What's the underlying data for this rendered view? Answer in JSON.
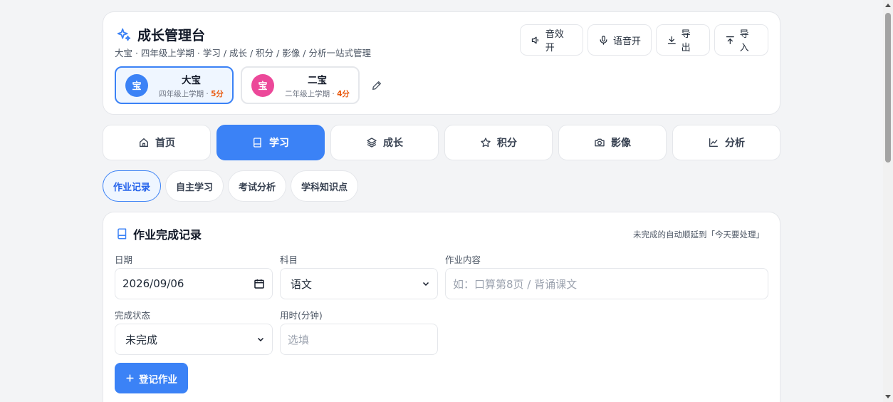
{
  "app": {
    "title": "成长管理台",
    "subtitle": "大宝 · 四年级上学期 · 学习 / 成长 / 积分 / 影像 / 分析一站式管理",
    "accent": "#3b82f6"
  },
  "top_actions": [
    {
      "label": "音效开",
      "icon": "speaker-icon"
    },
    {
      "label": "语音开",
      "icon": "microphone-icon"
    },
    {
      "label": "导出",
      "icon": "download-icon"
    },
    {
      "label": "导入",
      "icon": "upload-icon"
    }
  ],
  "kids": [
    {
      "avatar": "宝",
      "name": "大宝",
      "grade": "四年级上学期 · ",
      "score": "5分",
      "color": "#3b82f6",
      "active": true
    },
    {
      "avatar": "宝",
      "name": "二宝",
      "grade": "二年级上学期 · ",
      "score": "4分",
      "color": "#ec4899",
      "active": false
    }
  ],
  "tabs": [
    {
      "label": "首页",
      "icon": "home-icon"
    },
    {
      "label": "学习",
      "icon": "book-icon",
      "active": true
    },
    {
      "label": "成长",
      "icon": "layers-icon"
    },
    {
      "label": "积分",
      "icon": "star-icon"
    },
    {
      "label": "影像",
      "icon": "camera-icon"
    },
    {
      "label": "分析",
      "icon": "chart-icon"
    }
  ],
  "subtabs": [
    {
      "label": "作业记录",
      "active": true
    },
    {
      "label": "自主学习"
    },
    {
      "label": "考试分析"
    },
    {
      "label": "学科知识点"
    }
  ],
  "form": {
    "title": "作业完成记录",
    "note": "未完成的自动顺延到「今天要处理」",
    "date_label": "日期",
    "date_value": "2026/09/06",
    "subject_label": "科目",
    "subject_value": "语文",
    "content_label": "作业内容",
    "content_placeholder": "如：口算第8页 / 背诵课文",
    "status_label": "完成状态",
    "status_value": "未完成",
    "duration_label": "用时(分钟)",
    "duration_placeholder": "选填",
    "submit_label": "登记作业"
  }
}
